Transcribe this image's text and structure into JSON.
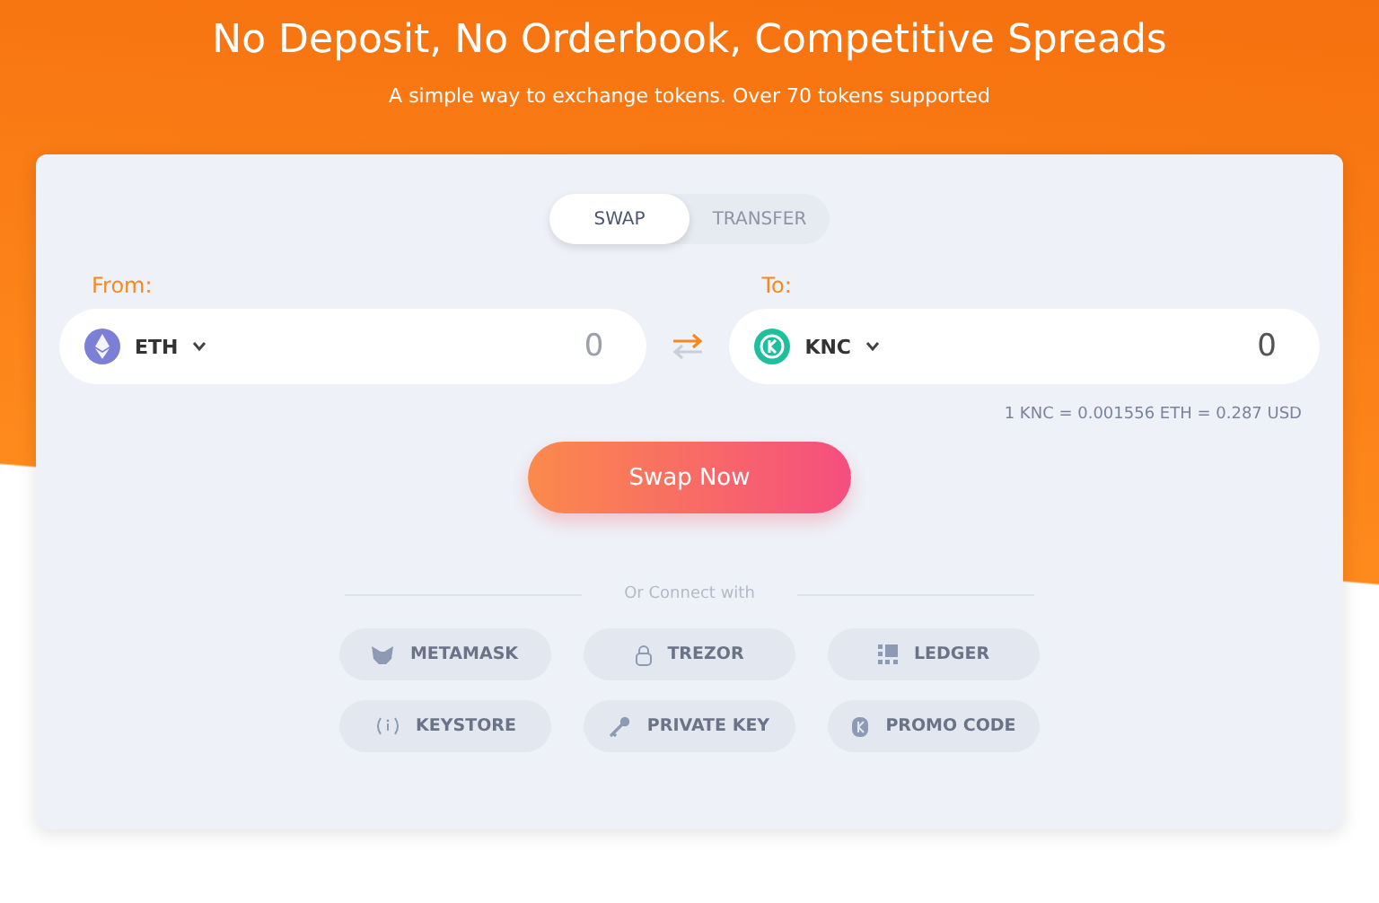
{
  "header": {
    "title": "No Deposit, No Orderbook, Competitive Spreads",
    "subtitle": "A simple way to exchange tokens. Over 70 tokens supported"
  },
  "tabs": [
    {
      "label": "SWAP",
      "selected": true
    },
    {
      "label": "TRANSFER",
      "selected": false
    }
  ],
  "from": {
    "label": "From:",
    "token": "ETH",
    "placeholder": "0"
  },
  "to": {
    "label": "To:",
    "token": "KNC",
    "placeholder": "0"
  },
  "rate": "1 KNC = 0.001556 ETH = 0.287 USD",
  "swap_button": "Swap Now",
  "connect_label": "Or Connect with",
  "wallets": [
    {
      "label": "METAMASK",
      "kind": "fox"
    },
    {
      "label": "TREZOR",
      "kind": "lock"
    },
    {
      "label": "LEDGER",
      "kind": "ledger"
    },
    {
      "label": "KEYSTORE",
      "kind": "keystore"
    },
    {
      "label": "PRIVATE KEY",
      "kind": "key"
    },
    {
      "label": "PROMO CODE",
      "kind": "promo"
    }
  ]
}
